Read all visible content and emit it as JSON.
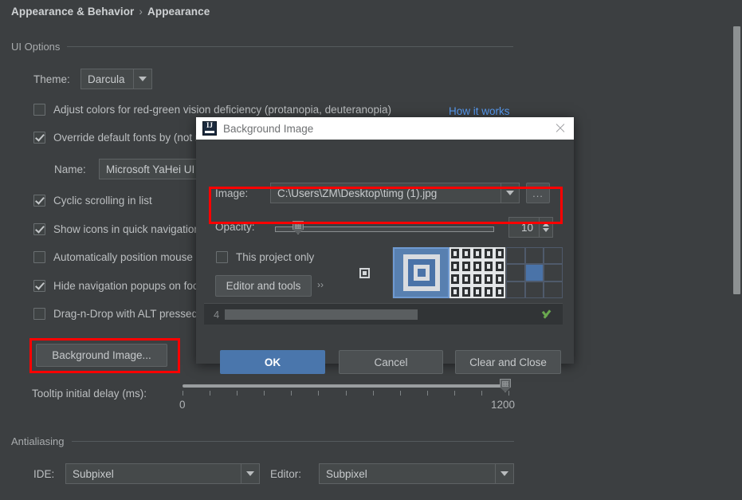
{
  "breadcrumb": {
    "root": "Appearance & Behavior",
    "separator": "›",
    "current": "Appearance"
  },
  "sections": {
    "ui_options": "UI Options",
    "antialiasing": "Antialiasing"
  },
  "theme": {
    "label": "Theme:",
    "value": "Darcula"
  },
  "checkboxes": [
    {
      "label": "Adjust colors for red-green vision deficiency (protanopia, deuteranopia)",
      "checked": false
    },
    {
      "label": "Override default fonts by (not recommended):",
      "checked": true
    },
    {
      "label": "Cyclic scrolling in list",
      "checked": true
    },
    {
      "label": "Show icons in quick navigation",
      "checked": true
    },
    {
      "label": "Automatically position mouse cursor on default button",
      "checked": false
    },
    {
      "label": "Hide navigation popups on focus loss",
      "checked": true
    },
    {
      "label": "Drag-n-Drop with ALT pressed only",
      "checked": false
    }
  ],
  "how_it_works_link": "How it works",
  "font": {
    "name_label": "Name:",
    "name_value": "Microsoft YaHei UI"
  },
  "background_image_button": "Background Image...",
  "tooltip": {
    "label": "Tooltip initial delay (ms):",
    "min": "0",
    "max": "1200",
    "value": 1200,
    "tick_count": 13
  },
  "antialiasing_row": {
    "ide_label": "IDE:",
    "ide_value": "Subpixel",
    "editor_label": "Editor:",
    "editor_value": "Subpixel"
  },
  "dialog": {
    "title": "Background Image",
    "app_icon": "intellij-idea-icon",
    "close_icon": "close-icon",
    "image_label": "Image:",
    "image_value": "C:\\Users\\ZM\\Desktop\\timg (1).jpg",
    "browse_label": "...",
    "opacity_label": "Opacity:",
    "opacity_value": "10",
    "this_project_only": {
      "label": "This project only",
      "checked": false
    },
    "scope_button": "Editor and tools",
    "scope_button_chevron": "››",
    "fill_modes": [
      {
        "name": "center",
        "selected": false
      },
      {
        "name": "scale",
        "selected": true
      },
      {
        "name": "tile",
        "selected": false
      },
      {
        "name": "position-grid",
        "selected": false
      }
    ],
    "aux_strip": {
      "number": "4",
      "check_icon": "green-check-icon"
    },
    "buttons": {
      "ok": "OK",
      "cancel": "Cancel",
      "clear_and_close": "Clear and Close"
    }
  },
  "colors": {
    "background": "#3c3f41",
    "field_background": "#45494a",
    "accent_blue": "#4a76ac",
    "link_blue": "#589df6",
    "highlight_red": "#ff0000",
    "title_bar": "#ffffff",
    "success_green": "#6aa84f"
  }
}
